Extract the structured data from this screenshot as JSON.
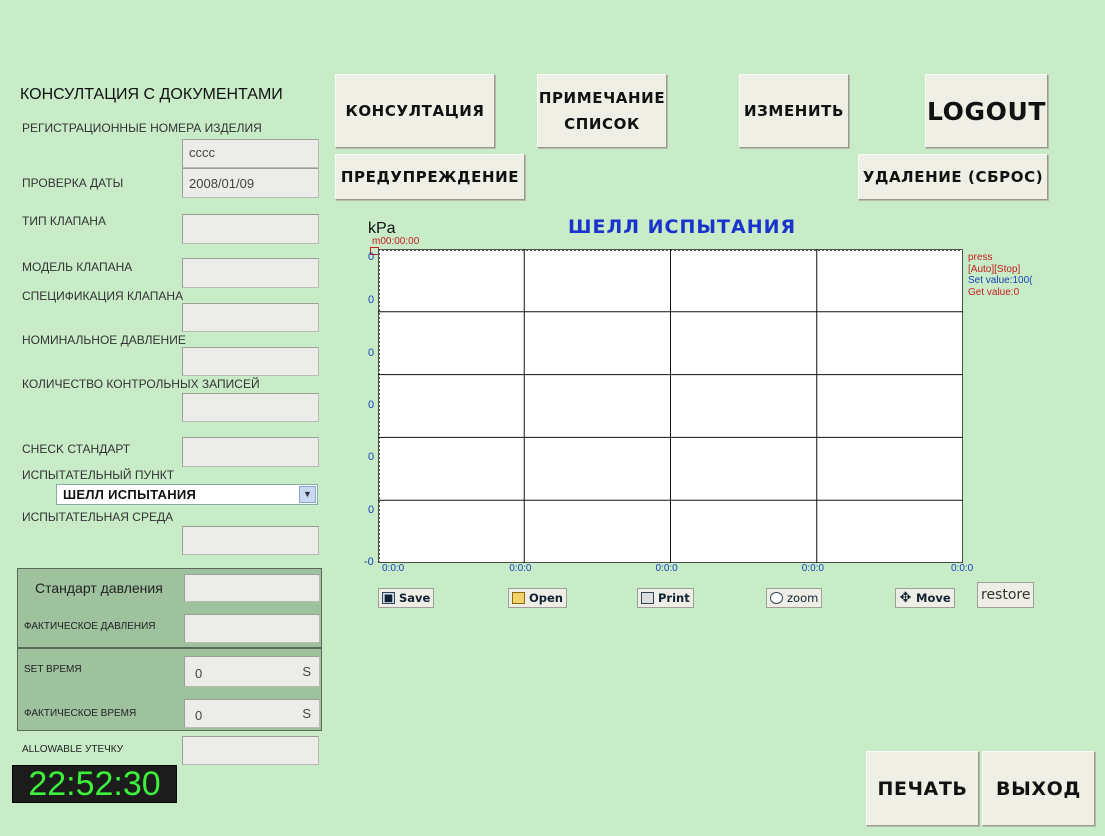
{
  "left_panel": {
    "heading": "КОНСУЛТАЦИЯ С ДОКУМЕНТАМИ",
    "reg_label": "РЕГИСТРАЦИОННЫЕ НОМЕРА ИЗДЕЛИЯ",
    "reg_value": "cccc",
    "date_label": "ПРОВЕРКА ДАТЫ",
    "date_value": "2008/01/09",
    "valve_type_label": "ТИП КЛАПАНА",
    "valve_type_value": "",
    "valve_model_label": "МОДЕЛЬ КЛАПАНА",
    "valve_model_value": "",
    "valve_spec_label": "СПЕЦИФИКАЦИЯ КЛАПАНА",
    "valve_spec_value": "",
    "nominal_pressure_label": "НОМИНАЛЬНОЕ ДАВЛЕНИЕ",
    "nominal_pressure_value": "",
    "records_count_label": "КОЛИЧЕСТВО КОНТРОЛЬНЫХ ЗАПИСЕЙ",
    "records_count_value": "",
    "check_standard_label": "CHECK СТАНДАРТ",
    "check_standard_value": "",
    "test_item_label": "ИСПЫТАТЕЛЬНЫЙ ПУНКТ",
    "test_item_value": "ШЕЛЛ ИСПЫТАНИЯ",
    "test_medium_label": "ИСПЫТАТЕЛЬНАЯ СРЕДА",
    "test_medium_value": ""
  },
  "pressure_panel": {
    "standard_label": "Стандарт давления",
    "standard_value": "",
    "actual_label": "ФАКТИЧЕСКОЕ ДАВЛЕНИЯ",
    "actual_value": ""
  },
  "time_panel": {
    "set_label": "SET ВРЕМЯ",
    "set_value": "0",
    "set_unit": "S",
    "actual_label": "ФАКТИЧЕСКОЕ ВРЕМЯ",
    "actual_value": "0",
    "actual_unit": "S"
  },
  "leak": {
    "label": "ALLOWABLE УТЕЧКУ",
    "value": ""
  },
  "clock": {
    "time": "22:52:30"
  },
  "buttons": {
    "consult": "КОНСУЛТАЦИЯ",
    "note_line1": "ПРИМЕЧАНИЕ",
    "note_line2": "СПИСОК",
    "edit": "ИЗМЕНИТЬ",
    "logout": "LOGOUT",
    "warning": "ПРЕДУПРЕЖДЕНИЕ",
    "delete": "УДАЛЕНИЕ (СБРОС)",
    "print": "ПЕЧАТЬ",
    "exit": "ВЫХОД"
  },
  "chart_data": {
    "type": "line",
    "title": "ШЕЛЛ ИСПЫТАНИЯ",
    "ylabel": "kPa",
    "time_marker": "00:00:00",
    "y_ticks": [
      "0",
      "0",
      "0",
      "0",
      "0",
      "0",
      "-0"
    ],
    "x_ticks": [
      "0:0:0",
      "0:0:0",
      "0:0:0",
      "0:0:0",
      "0:0:0"
    ],
    "series": [],
    "legend": {
      "name": "press",
      "status": "[Auto][Stop]",
      "set_value": "Set value:100(",
      "get_value": "Get value:0"
    },
    "grid": true
  },
  "chart_toolbar": {
    "save": "Save",
    "open": "Open",
    "print": "Print",
    "zoom": "zoom",
    "move": "Move",
    "restore": "restore"
  },
  "colors": {
    "background": "#c8ecc8",
    "title": "#1a33cc",
    "axis_ticks": "#1a40b8",
    "legend_red": "#c41e1e",
    "legend_blue": "#1a40b8",
    "clock_text": "#3cf03c"
  }
}
